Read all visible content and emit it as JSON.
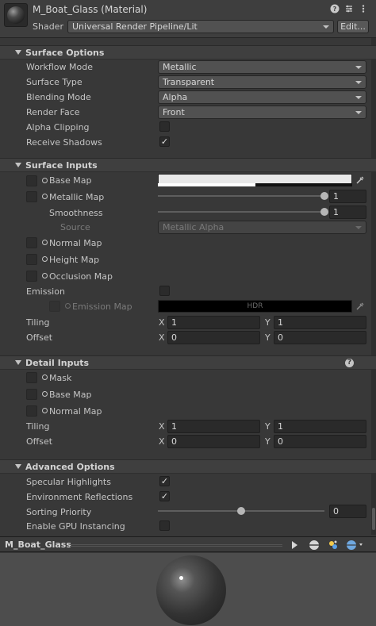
{
  "header": {
    "title": "M_Boat_Glass (Material)",
    "shader_label": "Shader",
    "shader_value": "Universal Render Pipeline/Lit",
    "edit_label": "Edit...",
    "icons": [
      "help-icon",
      "preset-icon",
      "menu-kebab-icon"
    ]
  },
  "surface_options": {
    "title": "Surface Options",
    "rows": [
      {
        "label": "Workflow Mode",
        "value": "Metallic"
      },
      {
        "label": "Surface Type",
        "value": "Transparent"
      },
      {
        "label": "Blending Mode",
        "value": "Alpha"
      },
      {
        "label": "Render Face",
        "value": "Front"
      }
    ],
    "alpha_clipping": {
      "label": "Alpha Clipping",
      "checked": false
    },
    "receive_shadows": {
      "label": "Receive Shadows",
      "checked": true
    }
  },
  "surface_inputs": {
    "title": "Surface Inputs",
    "base_map": {
      "label": "Base Map",
      "color": "#e8e8e8",
      "alpha_fraction": 0.5
    },
    "metallic_map": {
      "label": "Metallic Map",
      "value": "1",
      "slider_fraction": 1.0
    },
    "smoothness": {
      "label": "Smoothness",
      "value": "1",
      "slider_fraction": 1.0
    },
    "source": {
      "label": "Source",
      "value": "Metallic Alpha"
    },
    "normal_map": {
      "label": "Normal Map"
    },
    "height_map": {
      "label": "Height Map"
    },
    "occlusion_map": {
      "label": "Occlusion Map"
    },
    "emission": {
      "label": "Emission",
      "checked": false
    },
    "emission_map": {
      "label": "Emission Map",
      "hdr_label": "HDR",
      "color": "#000000"
    },
    "tiling": {
      "label": "Tiling",
      "x_label": "X",
      "x": "1",
      "y_label": "Y",
      "y": "1"
    },
    "offset": {
      "label": "Offset",
      "x_label": "X",
      "x": "0",
      "y_label": "Y",
      "y": "0"
    }
  },
  "detail_inputs": {
    "title": "Detail Inputs",
    "mask": {
      "label": "Mask"
    },
    "base_map": {
      "label": "Base Map"
    },
    "normal_map": {
      "label": "Normal Map"
    },
    "tiling": {
      "label": "Tiling",
      "x_label": "X",
      "x": "1",
      "y_label": "Y",
      "y": "1"
    },
    "offset": {
      "label": "Offset",
      "x_label": "X",
      "x": "0",
      "y_label": "Y",
      "y": "0"
    }
  },
  "advanced_options": {
    "title": "Advanced Options",
    "specular_highlights": {
      "label": "Specular Highlights",
      "checked": true
    },
    "environment_reflections": {
      "label": "Environment Reflections",
      "checked": true
    },
    "sorting_priority": {
      "label": "Sorting Priority",
      "value": "0",
      "slider_fraction": 0.5
    },
    "gpu_instancing": {
      "label": "Enable GPU Instancing",
      "checked": false
    }
  },
  "preview": {
    "name": "M_Boat_Glass",
    "check_glyph": "✓"
  }
}
